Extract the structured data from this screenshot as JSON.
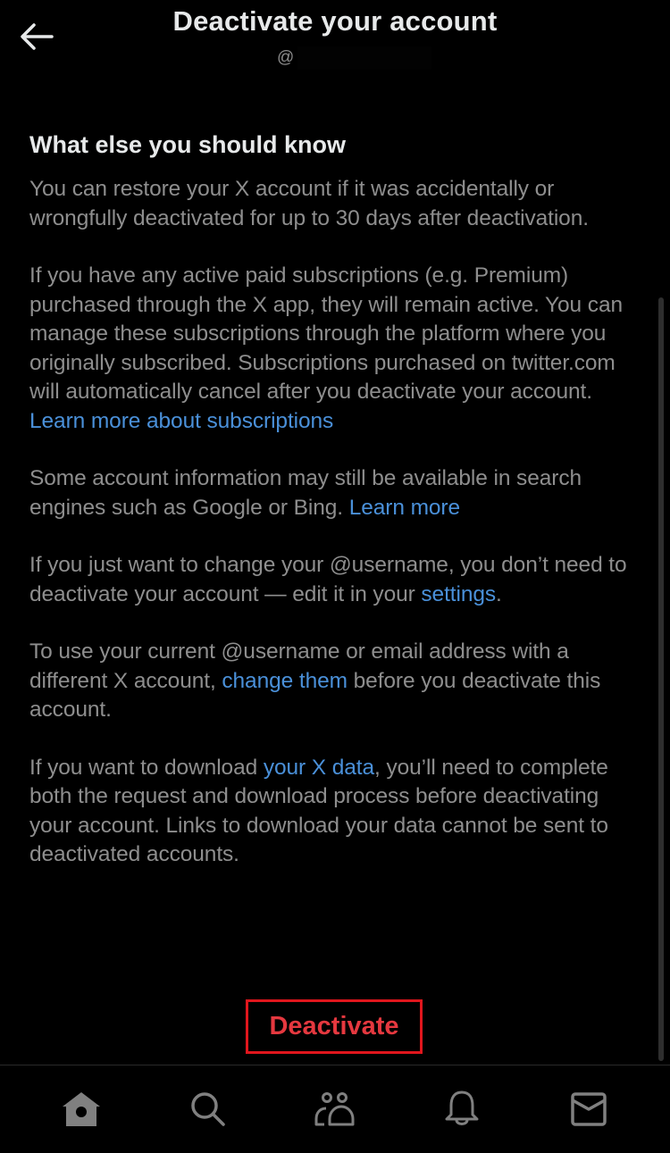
{
  "header": {
    "back_icon": "arrow-left-icon",
    "title": "Deactivate your account",
    "handle_prefix": "@",
    "handle_redacted": true
  },
  "content": {
    "section_title": "What else you should know",
    "paragraphs": [
      {
        "before": "You can restore your X account if it was accidentally or wrongfully deactivated for up to 30 days after deactivation.",
        "link": "",
        "after": ""
      },
      {
        "before": "If you have any active paid subscriptions (e.g. Premium) purchased through the X app, they will remain active. You can manage these subscriptions through the platform where you originally subscribed. Subscriptions purchased on twitter.com will automatically cancel after you deactivate your account. ",
        "link": "Learn more about subscriptions",
        "after": ""
      },
      {
        "before": "Some account information may still be available in search engines such as Google or Bing. ",
        "link": "Learn more",
        "after": ""
      },
      {
        "before": "If you just want to change your @username, you don’t need to deactivate your account — edit it in your ",
        "link": "settings",
        "after": "."
      },
      {
        "before": "To use your current @username or email address with a different X account, ",
        "link": "change them",
        "after": " before you deactivate this account."
      },
      {
        "before": "If you want to download ",
        "link": "your X data",
        "after": ", you’ll need to complete both the request and download process before deactivating your account. Links to download your data cannot be sent to deactivated accounts."
      }
    ]
  },
  "actions": {
    "deactivate_label": "Deactivate"
  },
  "bottom_nav": {
    "items": [
      {
        "name": "home",
        "icon": "home-icon"
      },
      {
        "name": "search",
        "icon": "search-icon"
      },
      {
        "name": "communities",
        "icon": "people-icon"
      },
      {
        "name": "notifications",
        "icon": "bell-icon"
      },
      {
        "name": "messages",
        "icon": "mail-icon"
      }
    ]
  },
  "colors": {
    "background": "#000000",
    "title_text": "#e7e9ea",
    "body_text": "#8e8e8e",
    "link": "#4a90d9",
    "danger": "#e5383f",
    "highlight_border": "#e0161d",
    "nav_icon": "#808080"
  }
}
